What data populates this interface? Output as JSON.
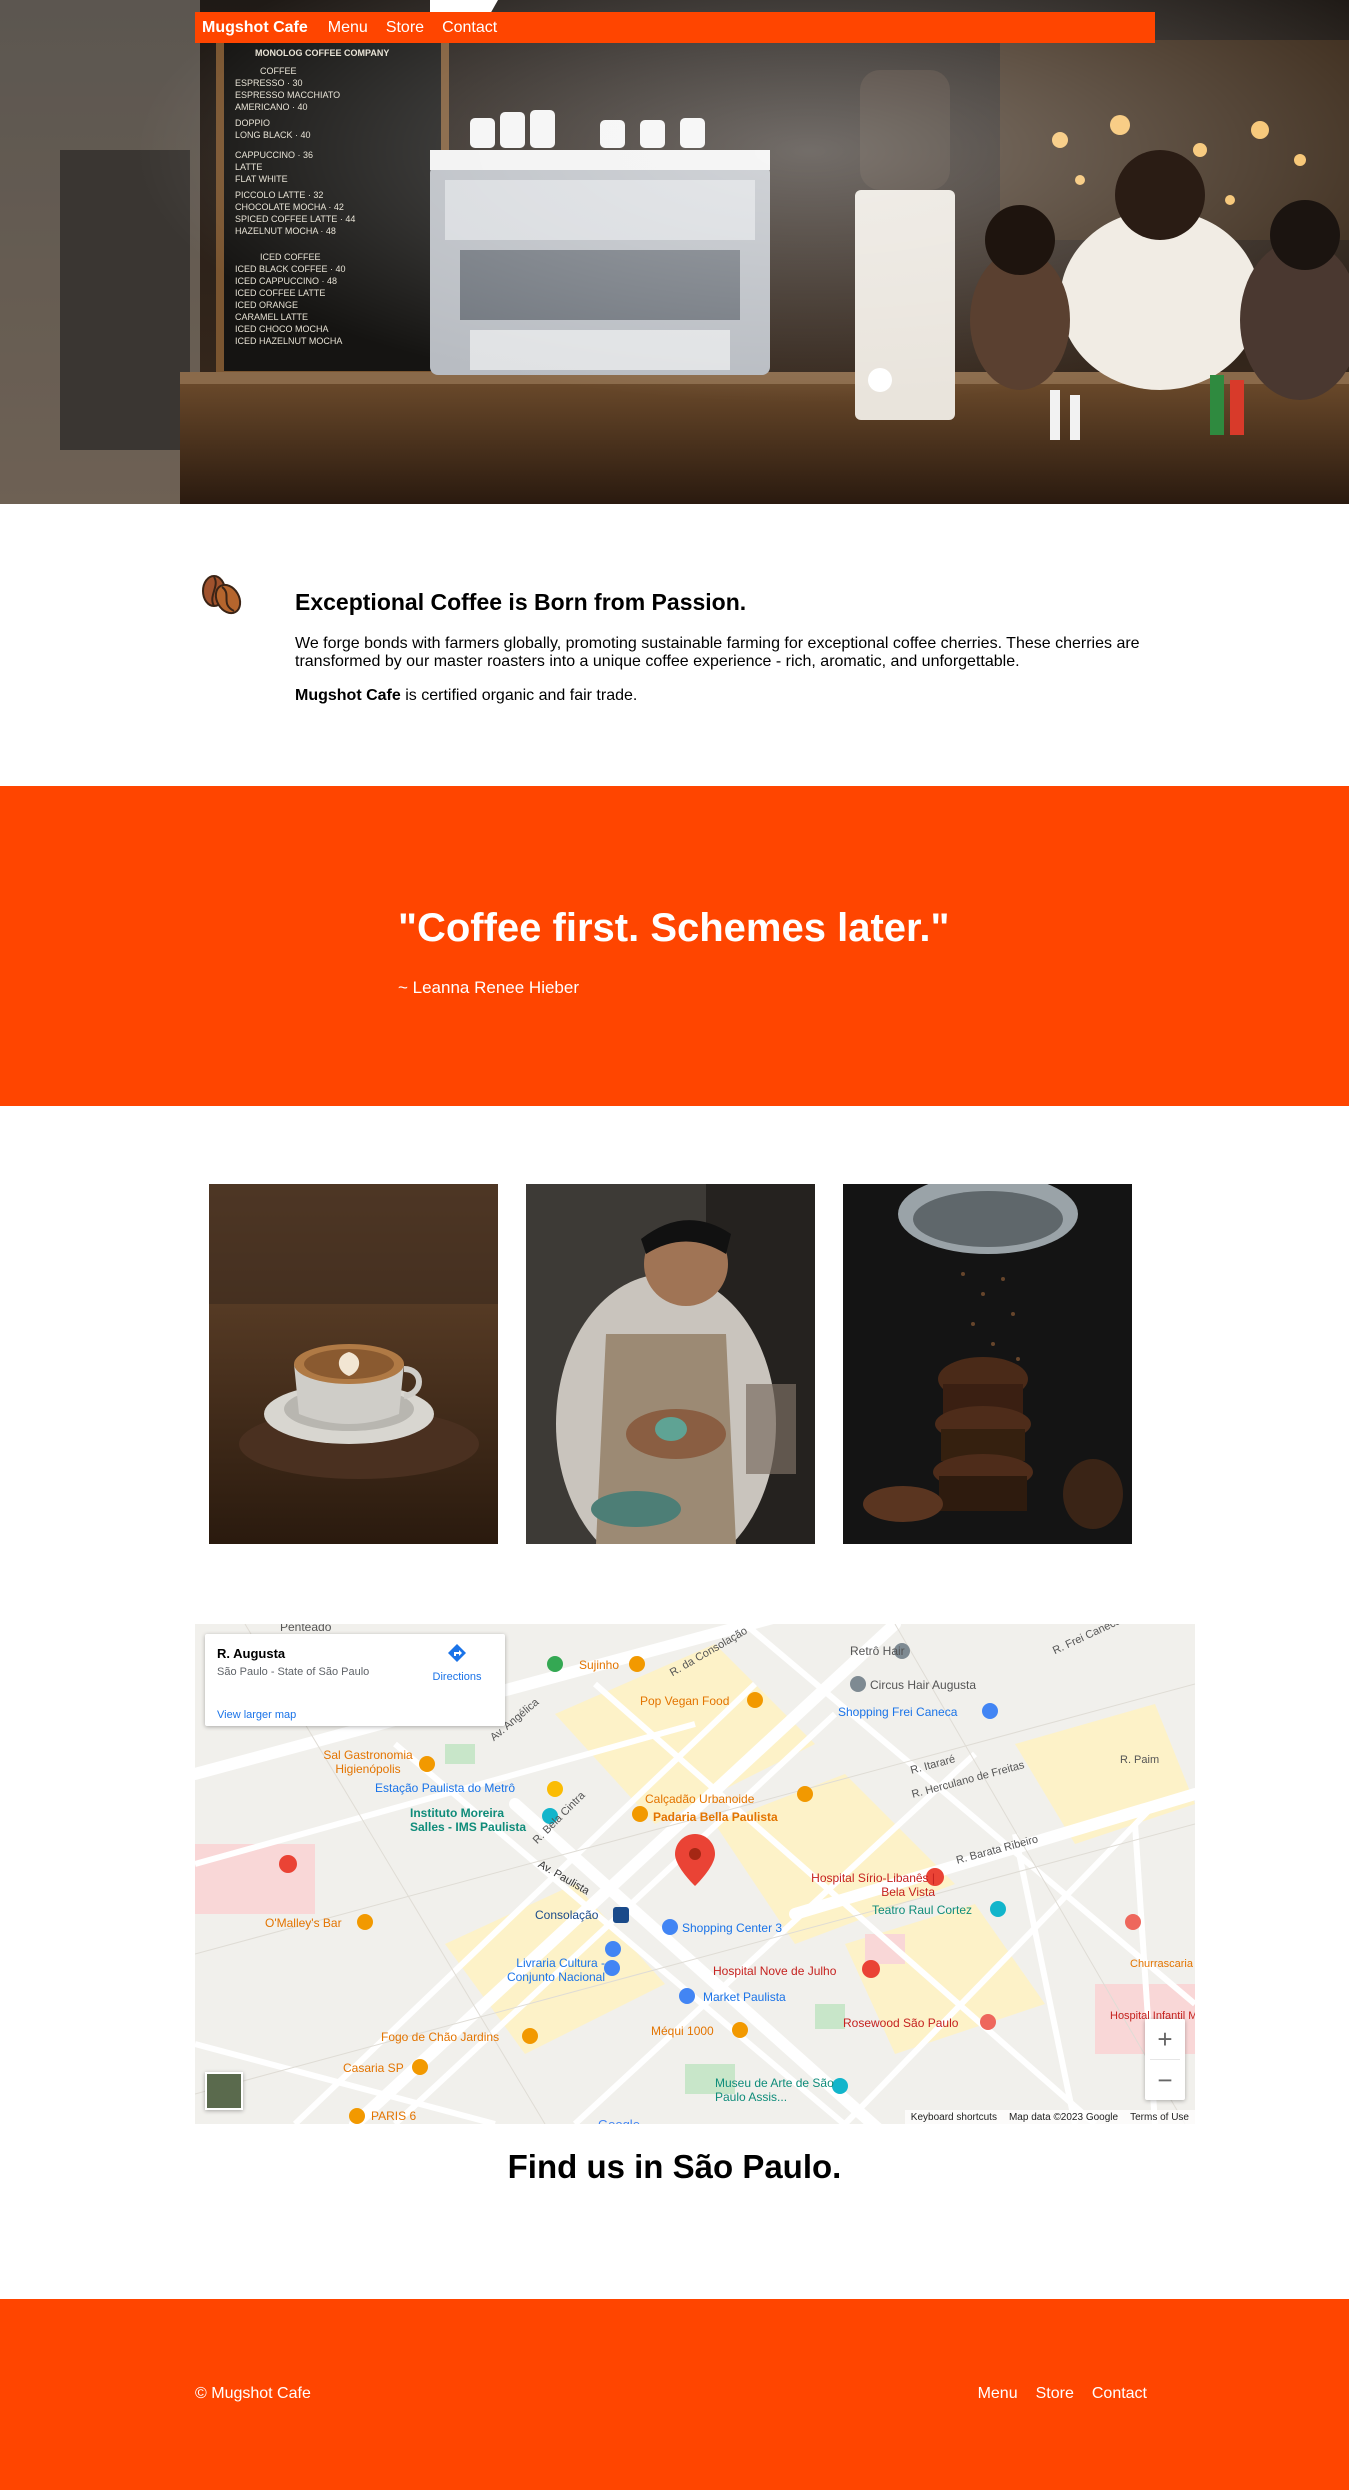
{
  "nav": {
    "brand": "Mugshot Cafe",
    "links": [
      "Menu",
      "Store",
      "Contact"
    ]
  },
  "hero": {
    "menu_board_lines": [
      "MONOLOG COFFEE COMPANY",
      "COFFEE",
      "ESPRESSO",
      "ESPRESSO MACCHIATO",
      "AMERICANO",
      "DOPPIO",
      "LONG BLACK",
      "CAPPUCCINO",
      "LATTE",
      "FLAT WHITE",
      "PICCOLO LATTE",
      "CHOCOLATE MOCHA",
      "SPICED COFFEE LATTE",
      "HAZELNUT MOCHA",
      "ICED COFFEE",
      "ICED BLACK COFFEE",
      "ICED CAPPUCCINO",
      "ICED COFFEE LATTE",
      "ICED ORANGE",
      "CARAMEL LATTE",
      "ICED CHOCO MOCHA",
      "ICED HAZELNUT MOCHA"
    ]
  },
  "passion": {
    "title": "Exceptional Coffee is Born from Passion.",
    "text": "We forge bonds with farmers globally, promoting sustainable farming for exceptional coffee cherries. These cherries are transformed by our master roasters into a unique coffee experience - rich, aromatic, and unforgettable.",
    "cert_brand": "Mugshot Cafe",
    "cert_rest": " is certified organic and fair trade."
  },
  "quote": {
    "text": "\"Coffee first. Schemes later.\"",
    "author": "~ Leanna Renee Hieber"
  },
  "gallery": [
    {
      "subject": "latte-art-cup"
    },
    {
      "subject": "barista-pouring"
    },
    {
      "subject": "chocolate-muffins"
    }
  ],
  "map": {
    "card_title": "R. Augusta",
    "card_sub": "São Paulo - State of São Paulo",
    "directions": "Directions",
    "larger_map": "View larger map",
    "footer": [
      "Keyboard shortcuts",
      "Map data ©2023 Google",
      "Terms of Use"
    ],
    "labels": [
      "Penteado",
      "Retrô Hair",
      "R. Frei Caneca",
      "Circus Hair Augusta",
      "Sujinho",
      "R. da Consolação",
      "Pop Vegan Food",
      "Shopping Frei Caneca",
      "Av. Angélica",
      "Sal Gastronomia Higienópolis",
      "R. Itararé",
      "R. Herculano de Freitas",
      "R. Paim",
      "Estação Paulista do Metrô",
      "Calçadão Urbanoide",
      "Instituto Moreira Salles - IMS Paulista",
      "Padaria Bella Paulista",
      "R. Bela Cintra",
      "Av. Paulista",
      "R. Barata Ribeiro",
      "Hospital Sírio-Libanês | Bela Vista",
      "Consolação",
      "Teatro Raul Cortez",
      "O'Malley's Bar",
      "Shopping Center 3",
      "Livraria Cultura - Conjunto Nacional",
      "Hospital Nove de Julho",
      "Market Paulista",
      "Rosewood São Paulo",
      "Fogo de Chão Jardins",
      "Méqui 1000",
      "Casaria SP",
      "Museu de Arte de São Paulo Assis...",
      "PARIS 6",
      "Churrascaria do Carne Ma",
      "Hospital Infantil M"
    ],
    "zoom_in": "+",
    "zoom_out": "−"
  },
  "find": {
    "title": "Find us in São Paulo."
  },
  "footer": {
    "copyright": "© Mugshot Cafe",
    "links": [
      "Menu",
      "Store",
      "Contact"
    ]
  },
  "colors": {
    "accent": "#ff4500"
  }
}
